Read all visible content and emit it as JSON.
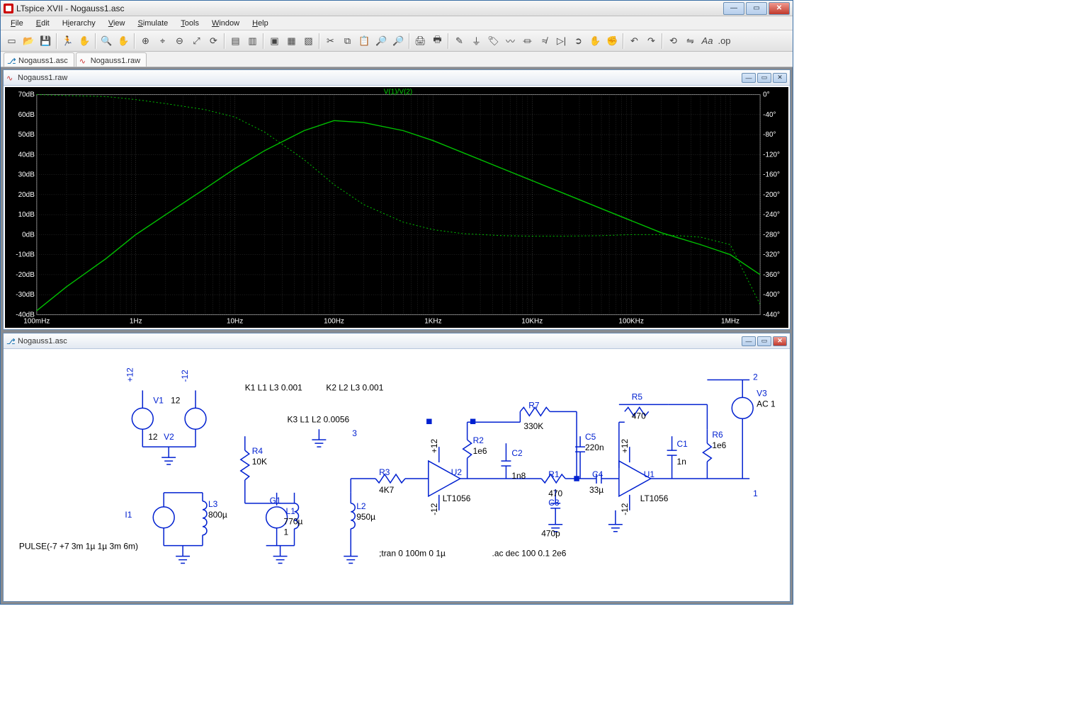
{
  "titlebar": {
    "app": "LTspice XVII",
    "doc": "Nogauss1.asc"
  },
  "menus": [
    "File",
    "Edit",
    "Hierarchy",
    "View",
    "Simulate",
    "Tools",
    "Window",
    "Help"
  ],
  "toolbar_icons": [
    "new",
    "open",
    "save",
    "sep",
    "run",
    "stop",
    "sep",
    "find",
    "hand",
    "sep",
    "zoom-in",
    "pan",
    "zoom-out",
    "zoom-fit",
    "autoscale",
    "sep",
    "tile-h",
    "tile-v",
    "sep",
    "close-win",
    "copy-bmp",
    "print-setup",
    "sep",
    "cut",
    "copy",
    "paste",
    "find2",
    "find3",
    "sep",
    "print",
    "print-preview",
    "sep",
    "wire",
    "ground",
    "label",
    "resistor",
    "capacitor",
    "inductor",
    "diode",
    "component",
    "move",
    "drag",
    "sep",
    "undo",
    "redo",
    "sep",
    "rotate",
    "mirror",
    "text",
    "spice-dir"
  ],
  "tabs": [
    {
      "label": "Nogauss1.asc",
      "icon": "schematic-icon"
    },
    {
      "label": "Nogauss1.raw",
      "icon": "waveform-icon"
    }
  ],
  "plot_window": {
    "title": "Nogauss1.raw"
  },
  "schematic_window": {
    "title": "Nogauss1.asc"
  },
  "chart_data": {
    "type": "line",
    "title": "V(1)/V(2)",
    "xlabel": "",
    "ylabel_left": "dB",
    "ylabel_right": "°",
    "x_log": true,
    "x_ticks": [
      "100mHz",
      "1Hz",
      "10Hz",
      "100Hz",
      "1KHz",
      "10KHz",
      "100KHz",
      "1MHz"
    ],
    "y_left_ticks": [
      70,
      60,
      50,
      40,
      30,
      20,
      10,
      0,
      -10,
      -20,
      -30,
      -40
    ],
    "y_right_ticks": [
      0,
      -40,
      -80,
      -120,
      -160,
      -200,
      -240,
      -280,
      -320,
      -360,
      -400,
      -440
    ],
    "xlim": [
      0.1,
      2000000
    ],
    "ylim_left": [
      -40,
      70
    ],
    "ylim_right": [
      -440,
      0
    ],
    "series": [
      {
        "name": "magnitude_dB",
        "style": "solid",
        "color": "#00c000",
        "x": [
          0.1,
          0.2,
          0.5,
          1,
          2,
          5,
          10,
          20,
          50,
          100,
          200,
          500,
          1000,
          2000,
          5000,
          10000,
          20000,
          50000,
          100000,
          200000,
          500000,
          1000000,
          2000000
        ],
        "y": [
          -38,
          -26,
          -12,
          0,
          10,
          23,
          33,
          42,
          52,
          57,
          56,
          52,
          47,
          41,
          33,
          27,
          21,
          13,
          7,
          1,
          -5,
          -10,
          -20
        ]
      },
      {
        "name": "phase_deg",
        "style": "dashed",
        "color": "#00c000",
        "x": [
          0.1,
          0.2,
          0.5,
          1,
          2,
          5,
          10,
          20,
          50,
          100,
          200,
          500,
          1000,
          2000,
          5000,
          10000,
          20000,
          50000,
          100000,
          200000,
          500000,
          1000000,
          2000000
        ],
        "y": [
          0,
          -2,
          -4,
          -10,
          -18,
          -30,
          -45,
          -75,
          -130,
          -180,
          -220,
          -255,
          -270,
          -278,
          -282,
          -283,
          -283,
          -282,
          -280,
          -280,
          -285,
          -300,
          -420
        ]
      }
    ]
  },
  "schematic": {
    "couplings": [
      "K1 L1 L3 0.001",
      "K2 L2 L3 0.001",
      "K3 L1 L2 0.0056"
    ],
    "directives": [
      ";tran 0 100m 0 1µ",
      ".ac dec 100 0.1 2e6"
    ],
    "pulse": "PULSE(-7 +7 3m 1µ 1µ 3m 6m)",
    "parts": {
      "V1": {
        "name": "V1",
        "val": "12"
      },
      "V2": {
        "name": "V2",
        "val": "12"
      },
      "rail_p": "+12",
      "rail_n": "-12",
      "I1": "I1",
      "L3": {
        "name": "L3",
        "val": "800µ"
      },
      "R4": {
        "name": "R4",
        "val": "10K"
      },
      "G1": {
        "name": "G1",
        "val": "1"
      },
      "L1": {
        "name": "L1",
        "val": "770µ"
      },
      "L2": {
        "name": "L2",
        "val": "950µ"
      },
      "R3": {
        "name": "R3",
        "val": "4K7"
      },
      "U2": {
        "name": "U2",
        "model": "LT1056"
      },
      "R2": {
        "name": "R2",
        "val": "1e6"
      },
      "C2": {
        "name": "C2",
        "val": "1n8"
      },
      "R7": {
        "name": "R7",
        "val": "330K"
      },
      "C5": {
        "name": "C5",
        "val": "220n"
      },
      "R1": {
        "name": "R1",
        "val": "470"
      },
      "C3": {
        "name": "C3",
        "val": "470p"
      },
      "C4": {
        "name": "C4",
        "val": "33µ"
      },
      "U1": {
        "name": "U1",
        "model": "LT1056"
      },
      "R5": {
        "name": "R5",
        "val": "470"
      },
      "C1": {
        "name": "C1",
        "val": "1n"
      },
      "R6": {
        "name": "R6",
        "val": "1e6"
      },
      "V3": {
        "name": "V3",
        "val": "AC 1"
      },
      "node3": "3",
      "node2": "2",
      "node1": "1"
    }
  }
}
